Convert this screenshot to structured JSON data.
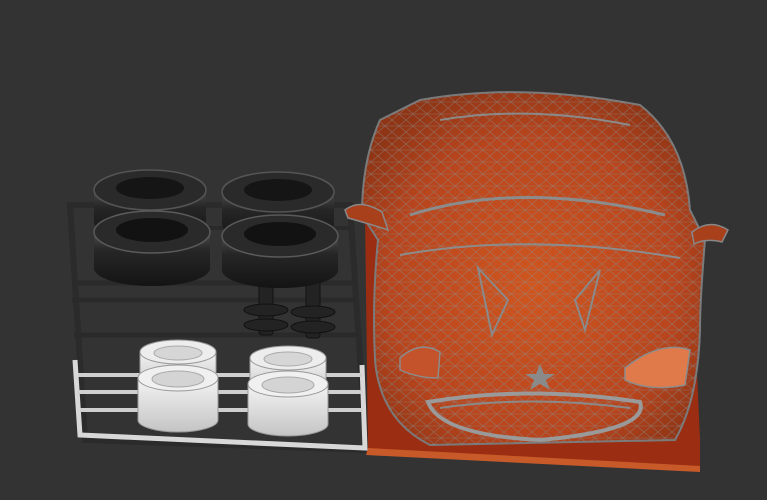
{
  "viewport": {
    "background": "#333333",
    "colors": {
      "tire": "#1f1f1f",
      "tire_highlight": "#4a4a4a",
      "sprue_dark": "#2b2b2b",
      "sprue_light": "#d8d8d8",
      "rim": "#e6e6e6",
      "body_fill": "#b8451d",
      "body_wire": "#7a7a7a",
      "base_plate": "#9b2e12"
    }
  }
}
